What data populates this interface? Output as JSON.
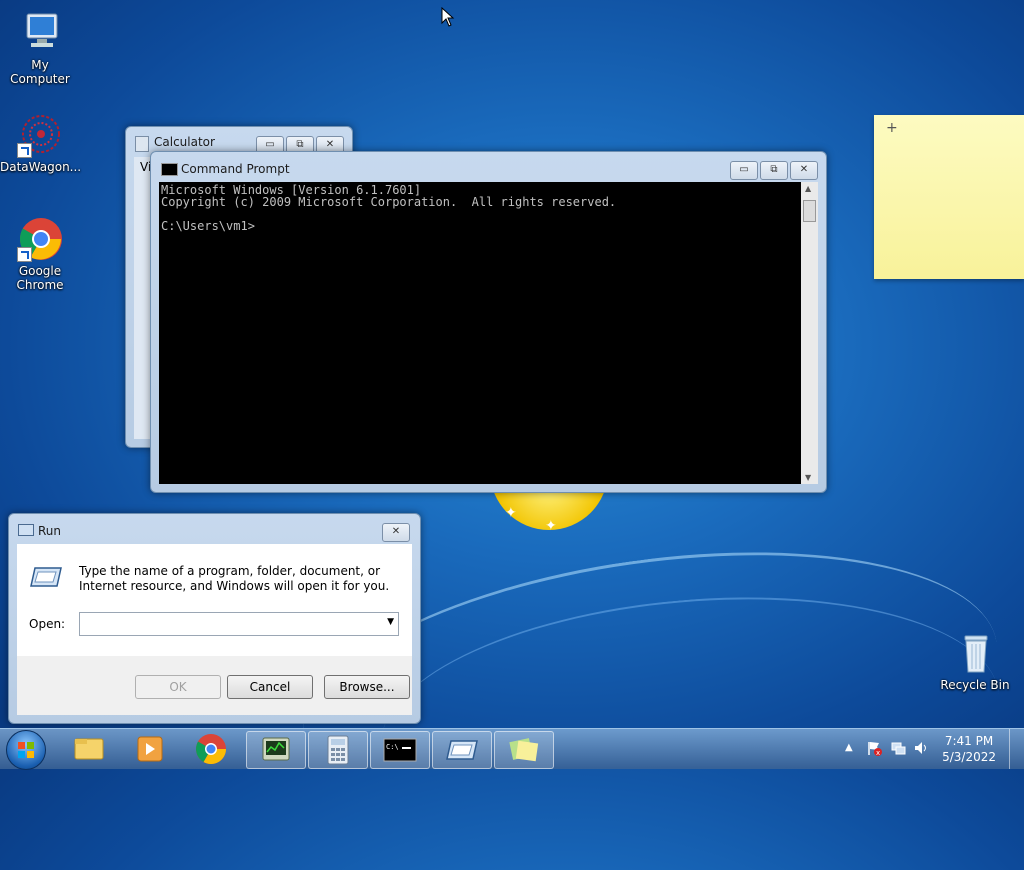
{
  "desktop": {
    "icons": [
      {
        "label": "My Computer",
        "icon": "computer-icon"
      },
      {
        "label": "DataWagon...",
        "icon": "datawagon-icon"
      },
      {
        "label": "Google Chrome",
        "icon": "chrome-icon"
      },
      {
        "label": "Recycle Bin",
        "icon": "recycle-bin-icon"
      }
    ]
  },
  "calculator": {
    "title": "Calculator",
    "menu_partial": "Vi"
  },
  "cmd": {
    "title": "Command Prompt",
    "output": "Microsoft Windows [Version 6.1.7601]\nCopyright (c) 2009 Microsoft Corporation.  All rights reserved.\n\nC:\\Users\\vm1>"
  },
  "run": {
    "title": "Run",
    "description": "Type the name of a program, folder, document, or Internet resource, and Windows will open it for you.",
    "open_label": "Open:",
    "open_value": "",
    "ok_label": "OK",
    "cancel_label": "Cancel",
    "browse_label": "Browse..."
  },
  "sticky": {
    "add_label": "+"
  },
  "window_controls": {
    "minimize": "▭",
    "maximize": "⧉",
    "close": "✕"
  },
  "taskbar": {
    "time": "7:41 PM",
    "date": "5/3/2022",
    "items": [
      "start-orb",
      "explorer",
      "media-player",
      "chrome",
      "task-manager",
      "calculator",
      "command-prompt",
      "run",
      "sticky-notes"
    ]
  },
  "colors": {
    "accent": "#1a6bbd",
    "console_bg": "#000000",
    "console_fg": "#c0c0c0",
    "sticky": "#fdfbc1"
  }
}
